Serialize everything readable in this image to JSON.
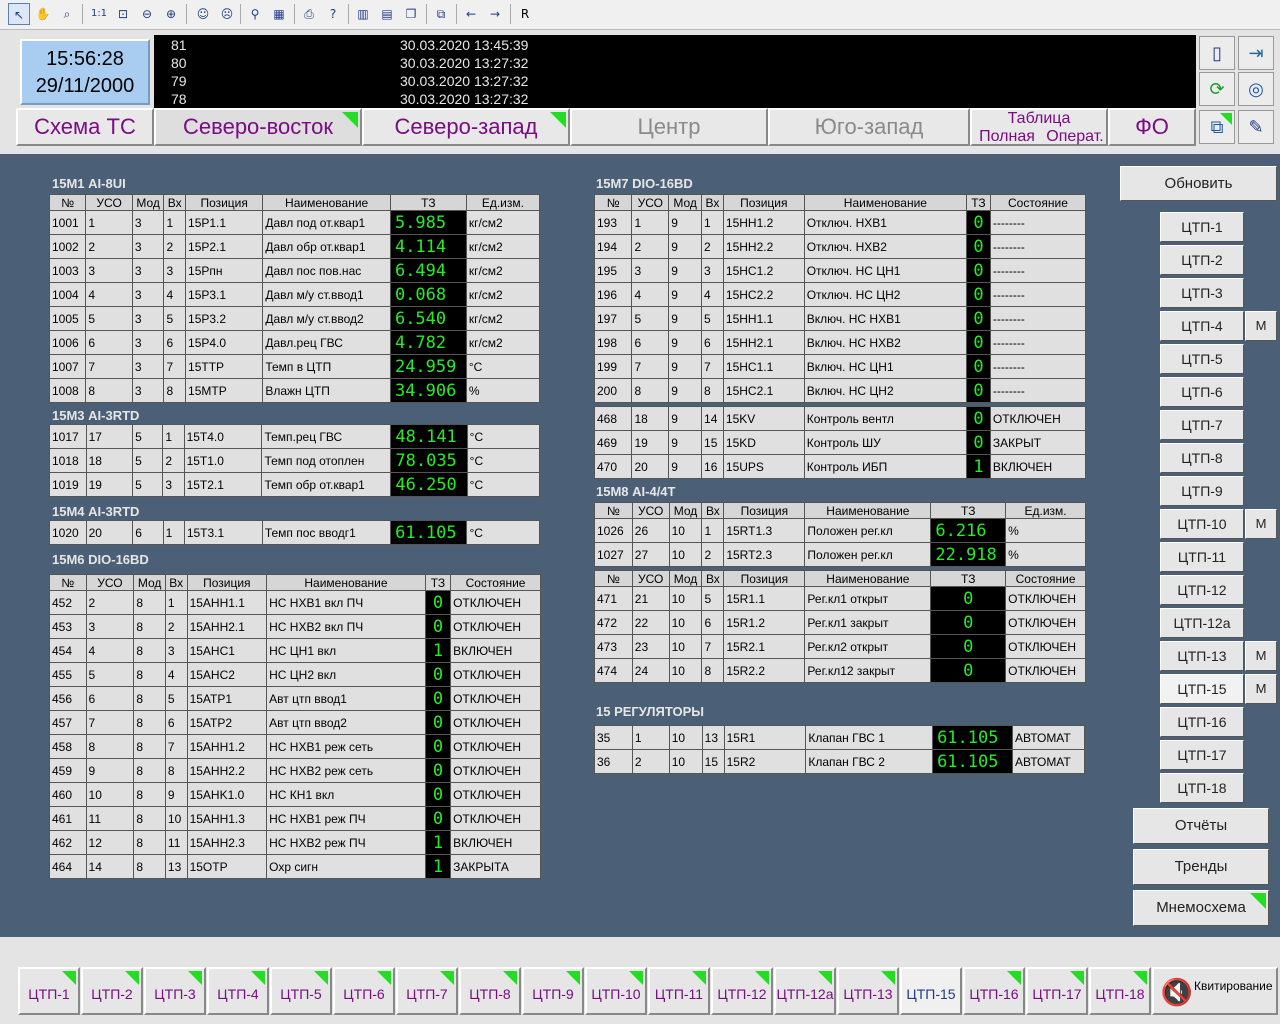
{
  "clock": {
    "time": "15:56:28",
    "date": "29/11/2000"
  },
  "log": [
    {
      "num": "81",
      "ts": "30.03.2020 13:45:39"
    },
    {
      "num": "80",
      "ts": "30.03.2020 13:27:32"
    },
    {
      "num": "79",
      "ts": "30.03.2020 13:27:32"
    },
    {
      "num": "78",
      "ts": "30.03.2020 13:27:32"
    }
  ],
  "toolbar": {
    "r_label": "R",
    "zoom_label": "1:1"
  },
  "tabs": {
    "schema": "Схема ТС",
    "ne": "Северо-восток",
    "nw": "Северо-запад",
    "center": "Центр",
    "sw": "Юго-запад",
    "table_title": "Таблица",
    "table_full": "Полная",
    "table_oper": "Операт.",
    "fo": "ФО"
  },
  "sections": {
    "m1": {
      "title": "15М1 AI-8UI",
      "headers": [
        "№",
        "УСО",
        "Мод",
        "Вх",
        "Позиция",
        "Наименование",
        "ТЗ",
        "Ед.изм."
      ],
      "rows": [
        [
          "1001",
          "1",
          "3",
          "1",
          "15P1.1",
          "Давл под от.квар1",
          "5.985",
          "кг/см2"
        ],
        [
          "1002",
          "2",
          "3",
          "2",
          "15P2.1",
          "Давл обр от.квар1",
          "4.114",
          "кг/см2"
        ],
        [
          "1003",
          "3",
          "3",
          "3",
          "15Pпн",
          "Давл пос пов.нас",
          "6.494",
          "кг/см2"
        ],
        [
          "1004",
          "4",
          "3",
          "4",
          "15P3.1",
          "Давл м/у ст.ввод1",
          "0.068",
          "кг/см2"
        ],
        [
          "1005",
          "5",
          "3",
          "5",
          "15P3.2",
          "Давл м/у ст.ввод2",
          "6.540",
          "кг/см2"
        ],
        [
          "1006",
          "6",
          "3",
          "6",
          "15P4.0",
          "Давл.рец ГВС",
          "4.782",
          "кг/см2"
        ],
        [
          "1007",
          "7",
          "3",
          "7",
          "15TTP",
          "Темп в ЦТП",
          "24.959",
          "°C"
        ],
        [
          "1008",
          "8",
          "3",
          "8",
          "15MTP",
          "Влажн ЦТП",
          "34.906",
          "%"
        ]
      ]
    },
    "m3": {
      "title": "15М3 AI-3RTD",
      "rows": [
        [
          "1017",
          "17",
          "5",
          "1",
          "15T4.0",
          "Темп.рец ГВС",
          "48.141",
          "°C"
        ],
        [
          "1018",
          "18",
          "5",
          "2",
          "15T1.0",
          "Темп под отоплен",
          "78.035",
          "°C"
        ],
        [
          "1019",
          "19",
          "5",
          "3",
          "15T2.1",
          "Темп обр от.квар1",
          "46.250",
          "°C"
        ]
      ]
    },
    "m4": {
      "title": "15М4 AI-3RTD",
      "rows": [
        [
          "1020",
          "20",
          "6",
          "1",
          "15T3.1",
          "Темп пос вводг1",
          "61.105",
          "°C"
        ]
      ]
    },
    "m6": {
      "title": "15М6 DIO-16BD",
      "headers": [
        "№",
        "УСО",
        "Мод",
        "Вх",
        "Позиция",
        "Наименование",
        "ТЗ",
        "Состояние"
      ],
      "rows": [
        [
          "452",
          "2",
          "8",
          "1",
          "15AHH1.1",
          "НС НХВ1 вкл ПЧ",
          "0",
          "ОТКЛЮЧЕН"
        ],
        [
          "453",
          "3",
          "8",
          "2",
          "15AHH2.1",
          "НС НХВ2 вкл ПЧ",
          "0",
          "ОТКЛЮЧЕН"
        ],
        [
          "454",
          "4",
          "8",
          "3",
          "15AHC1",
          "НС ЦН1 вкл",
          "1",
          "ВКЛЮЧЕН"
        ],
        [
          "455",
          "5",
          "8",
          "4",
          "15AHC2",
          "НС ЦН2 вкл",
          "0",
          "ОТКЛЮЧЕН"
        ],
        [
          "456",
          "6",
          "8",
          "5",
          "15ATP1",
          "Авт цтп ввод1",
          "0",
          "ОТКЛЮЧЕН"
        ],
        [
          "457",
          "7",
          "8",
          "6",
          "15ATP2",
          "Авт цтп ввод2",
          "0",
          "ОТКЛЮЧЕН"
        ],
        [
          "458",
          "8",
          "8",
          "7",
          "15AHH1.2",
          "НС НХВ1 реж сеть",
          "0",
          "ОТКЛЮЧЕН"
        ],
        [
          "459",
          "9",
          "8",
          "8",
          "15AHH2.2",
          "НС НХВ2 реж сеть",
          "0",
          "ОТКЛЮЧЕН"
        ],
        [
          "460",
          "10",
          "8",
          "9",
          "15AHK1.0",
          "НС КН1 вкл",
          "0",
          "ОТКЛЮЧЕН"
        ],
        [
          "461",
          "11",
          "8",
          "10",
          "15AHH1.3",
          "НС НХВ1 реж ПЧ",
          "0",
          "ОТКЛЮЧЕН"
        ],
        [
          "462",
          "12",
          "8",
          "11",
          "15AHH2.3",
          "НС НХВ2 реж ПЧ",
          "1",
          "ВКЛЮЧЕН"
        ],
        [
          "464",
          "14",
          "8",
          "13",
          "15OTP",
          "Охр сигн",
          "1",
          "ЗАКРЫТА"
        ]
      ]
    },
    "m7": {
      "title": "15М7 DIO-16BD",
      "headers": [
        "№",
        "УСО",
        "Мод",
        "Вх",
        "Позиция",
        "Наименование",
        "ТЗ",
        "Состояние"
      ],
      "rows": [
        [
          "193",
          "1",
          "9",
          "1",
          "15HH1.2",
          "Отключ. НХВ1",
          "0",
          "--------"
        ],
        [
          "194",
          "2",
          "9",
          "2",
          "15HH2.2",
          "Отключ. НХВ2",
          "0",
          "--------"
        ],
        [
          "195",
          "3",
          "9",
          "3",
          "15HC1.2",
          "Отключ. НС ЦН1",
          "0",
          "--------"
        ],
        [
          "196",
          "4",
          "9",
          "4",
          "15HC2.2",
          "Отключ. НС ЦН2",
          "0",
          "--------"
        ],
        [
          "197",
          "5",
          "9",
          "5",
          "15HH1.1",
          "Включ. НС НХВ1",
          "0",
          "--------"
        ],
        [
          "198",
          "6",
          "9",
          "6",
          "15HH2.1",
          "Включ. НС НХВ2",
          "0",
          "--------"
        ],
        [
          "199",
          "7",
          "9",
          "7",
          "15HC1.1",
          "Включ. НС ЦН1",
          "0",
          "--------"
        ],
        [
          "200",
          "8",
          "9",
          "8",
          "15HC2.1",
          "Включ. НС ЦН2",
          "0",
          "--------"
        ]
      ],
      "rows2": [
        [
          "468",
          "18",
          "9",
          "14",
          "15KV",
          "Контроль вентл",
          "0",
          "ОТКЛЮЧЕН"
        ],
        [
          "469",
          "19",
          "9",
          "15",
          "15KD",
          "Контроль ШУ",
          "0",
          "ЗАКРЫТ"
        ],
        [
          "470",
          "20",
          "9",
          "16",
          "15UPS",
          "Контроль ИБП",
          "1",
          "ВКЛЮЧЕН"
        ]
      ]
    },
    "m8": {
      "title": "15М8 AI-4/4T",
      "headers": [
        "№",
        "УСО",
        "Мод",
        "Вх",
        "Позиция",
        "Наименование",
        "ТЗ",
        "Ед.изм."
      ],
      "rows": [
        [
          "1026",
          "26",
          "10",
          "1",
          "15RT1.3",
          "Положен рег.кл",
          "6.216",
          "%"
        ],
        [
          "1027",
          "27",
          "10",
          "2",
          "15RT2.3",
          "Положен рег.кл",
          "22.918",
          "%"
        ]
      ],
      "headers2": [
        "№",
        "УСО",
        "Мод",
        "Вх",
        "Позиция",
        "Наименование",
        "ТЗ",
        "Состояние"
      ],
      "rows2": [
        [
          "471",
          "21",
          "10",
          "5",
          "15R1.1",
          "Рег.кл1 открыт",
          "0",
          "ОТКЛЮЧЕН"
        ],
        [
          "472",
          "22",
          "10",
          "6",
          "15R1.2",
          "Рег.кл1 закрыт",
          "0",
          "ОТКЛЮЧЕН"
        ],
        [
          "473",
          "23",
          "10",
          "7",
          "15R2.1",
          "Рег.кл2 открыт",
          "0",
          "ОТКЛЮЧЕН"
        ],
        [
          "474",
          "24",
          "10",
          "8",
          "15R2.2",
          "Рег.кл12 закрыт",
          "0",
          "ОТКЛЮЧЕН"
        ]
      ]
    },
    "reg": {
      "title": "15 РЕГУЛЯТОРЫ",
      "rows": [
        [
          "35",
          "1",
          "10",
          "13",
          "15R1",
          "Клапан ГВС 1",
          "61.105",
          "АВТОМАТ"
        ],
        [
          "36",
          "2",
          "10",
          "15",
          "15R2",
          "Клапан ГВС 2",
          "61.105",
          "АВТОМАТ"
        ]
      ]
    }
  },
  "right": {
    "refresh": "Обновить",
    "ctp": [
      "ЦТП-1",
      "ЦТП-2",
      "ЦТП-3",
      "ЦТП-4",
      "ЦТП-5",
      "ЦТП-6",
      "ЦТП-7",
      "ЦТП-8",
      "ЦТП-9",
      "ЦТП-10",
      "ЦТП-11",
      "ЦТП-12",
      "ЦТП-12а",
      "ЦТП-13",
      "ЦТП-15",
      "ЦТП-16",
      "ЦТП-17",
      "ЦТП-18"
    ],
    "m_label": "М",
    "reports": "Отчёты",
    "trends": "Тренды",
    "mnemo": "Мнемосхема"
  },
  "bottom": {
    "tabs": [
      "ЦТП-1",
      "ЦТП-2",
      "ЦТП-3",
      "ЦТП-4",
      "ЦТП-5",
      "ЦТП-6",
      "ЦТП-7",
      "ЦТП-8",
      "ЦТП-9",
      "ЦТП-10",
      "ЦТП-11",
      "ЦТП-12",
      "ЦТП-12а",
      "ЦТП-13",
      "ЦТП-15",
      "ЦТП-16",
      "ЦТП-17",
      "ЦТП-18"
    ],
    "ack": "Квитирование"
  },
  "colors": {
    "panel_bg": "#4b6076",
    "value_green": "#22ee22",
    "label_purple": "#7a0c84"
  }
}
